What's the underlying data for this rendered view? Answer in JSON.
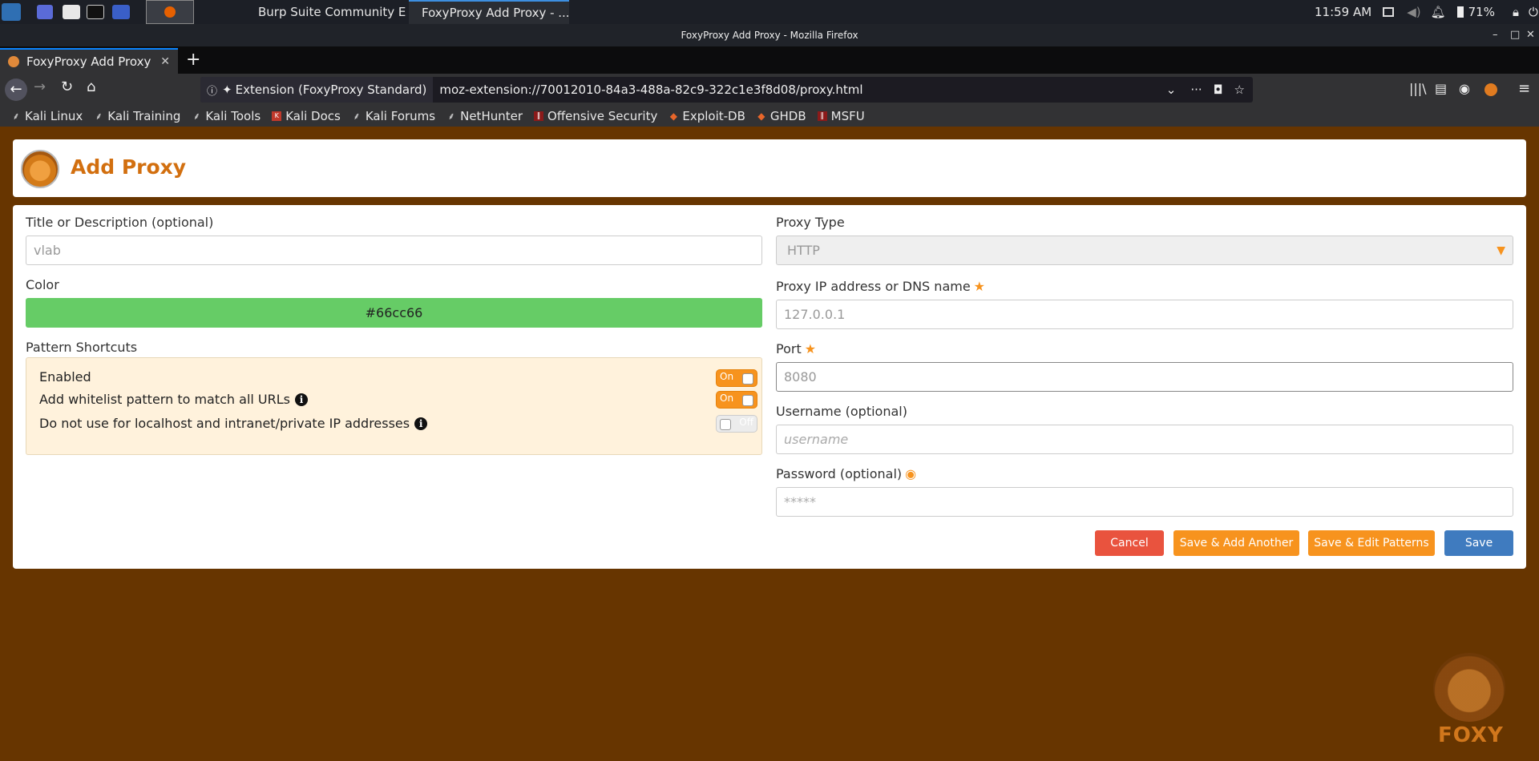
{
  "taskbar": {
    "tasks": [
      "Burp Suite Community E...",
      "FoxyProxy Add Proxy - ..."
    ],
    "time": "11:59 AM",
    "battery": "71%"
  },
  "window": {
    "title": "FoxyProxy Add Proxy - Mozilla Firefox"
  },
  "tab": {
    "label": "FoxyProxy Add Proxy"
  },
  "urlbar": {
    "identity": "Extension (FoxyProxy Standard)",
    "url": "moz-extension://70012010-84a3-488a-82c9-322c1e3f8d08/proxy.html"
  },
  "bookmarks": [
    "Kali Linux",
    "Kali Training",
    "Kali Tools",
    "Kali Docs",
    "Kali Forums",
    "NetHunter",
    "Offensive Security",
    "Exploit-DB",
    "GHDB",
    "MSFU"
  ],
  "page": {
    "title": "Add Proxy",
    "left": {
      "title_label": "Title or Description (optional)",
      "title_placeholder": "vlab",
      "color_label": "Color",
      "color_value": "#66cc66",
      "pattern_label": "Pattern Shortcuts",
      "patterns": [
        {
          "label": "Enabled",
          "toggle": "On"
        },
        {
          "label": "Add whitelist pattern to match all URLs",
          "toggle": "On"
        },
        {
          "label": "Do not use for localhost and intranet/private IP addresses",
          "toggle": "Off"
        }
      ]
    },
    "right": {
      "type_label": "Proxy Type",
      "type_value": "HTTP",
      "ip_label": "Proxy IP address or DNS name",
      "ip_placeholder": "127.0.0.1",
      "port_label": "Port",
      "port_placeholder": "8080",
      "user_label": "Username (optional)",
      "user_placeholder": "username",
      "pass_label": "Password (optional)",
      "pass_placeholder": "*****"
    },
    "buttons": {
      "cancel": "Cancel",
      "save_add": "Save & Add Another",
      "save_edit": "Save & Edit Patterns",
      "save": "Save"
    },
    "watermark": "FOXY"
  },
  "colors": {
    "accent": "#f7931e",
    "title": "#d26f0f",
    "background": "#673500",
    "cancel": "#e9533e",
    "save": "#3f7bbf"
  }
}
